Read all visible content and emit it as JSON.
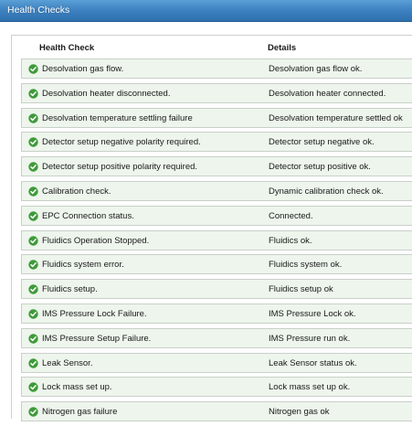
{
  "window": {
    "title": "Health Checks"
  },
  "table": {
    "columns": {
      "check": "Health Check",
      "details": "Details"
    },
    "rows": [
      {
        "check": "Desolvation gas flow.",
        "details": "Desolvation gas flow ok.",
        "status": "ok"
      },
      {
        "check": "Desolvation heater disconnected.",
        "details": "Desolvation heater connected.",
        "status": "ok"
      },
      {
        "check": "Desolvation temperature settling failure",
        "details": "Desolvation temperature settled ok",
        "status": "ok"
      },
      {
        "check": "Detector setup negative polarity required.",
        "details": "Detector setup negative ok.",
        "status": "ok"
      },
      {
        "check": "Detector setup positive polarity required.",
        "details": "Detector setup positive ok.",
        "status": "ok"
      },
      {
        "check": "Calibration check.",
        "details": "Dynamic calibration check ok.",
        "status": "ok"
      },
      {
        "check": "EPC Connection status.",
        "details": "Connected.",
        "status": "ok"
      },
      {
        "check": "Fluidics Operation Stopped.",
        "details": "Fluidics ok.",
        "status": "ok"
      },
      {
        "check": "Fluidics system error.",
        "details": "Fluidics system ok.",
        "status": "ok"
      },
      {
        "check": "Fluidics setup.",
        "details": "Fluidics setup ok",
        "status": "ok"
      },
      {
        "check": "IMS Pressure Lock Failure.",
        "details": "IMS Pressure Lock ok.",
        "status": "ok"
      },
      {
        "check": "IMS Pressure Setup Failure.",
        "details": "IMS Pressure run ok.",
        "status": "ok"
      },
      {
        "check": "Leak Sensor.",
        "details": "Leak Sensor status ok.",
        "status": "ok"
      },
      {
        "check": "Lock mass set up.",
        "details": "Lock mass set up ok.",
        "status": "ok"
      },
      {
        "check": "Nitrogen gas failure",
        "details": "Nitrogen gas ok",
        "status": "ok"
      }
    ]
  },
  "icons": {
    "status_ok": "check-circle-icon"
  },
  "colors": {
    "ok_icon": "#3f9a3a",
    "row_bg": "#edf5ec",
    "titlebar": "#3f83c2"
  }
}
